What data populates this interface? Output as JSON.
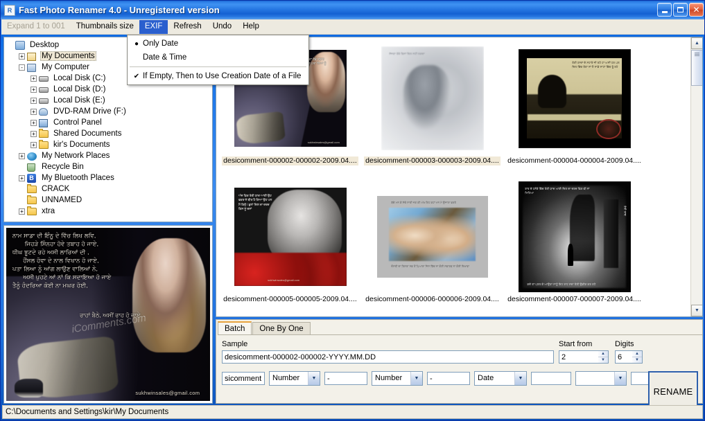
{
  "window": {
    "title": "Fast Photo Renamer 4.0 - Unregistered version",
    "icon": "app-icon",
    "minimize_label": "Minimize",
    "maximize_label": "Maximize",
    "close_label": "Close"
  },
  "menubar": {
    "items": [
      {
        "label": "Expand 1 to 001",
        "state": "disabled"
      },
      {
        "label": "Thumbnails size",
        "state": "normal"
      },
      {
        "label": "EXIF",
        "state": "active"
      },
      {
        "label": "Refresh",
        "state": "normal"
      },
      {
        "label": "Undo",
        "state": "normal"
      },
      {
        "label": "Help",
        "state": "normal"
      }
    ]
  },
  "exif_menu": {
    "items": [
      {
        "label": "Only Date",
        "mark": "●"
      },
      {
        "label": "Date & Time",
        "mark": ""
      },
      {
        "label": "If Empty, Then to Use Creation Date of a File",
        "mark": "✔"
      }
    ]
  },
  "tree": {
    "nodes": [
      {
        "label": "Desktop",
        "indent": 0,
        "expander": "",
        "icon": "desktop-icon",
        "selected": false
      },
      {
        "label": "My Documents",
        "indent": 1,
        "expander": "+",
        "icon": "documents-icon",
        "selected": true
      },
      {
        "label": "My Computer",
        "indent": 1,
        "expander": "-",
        "icon": "computer-icon",
        "selected": false
      },
      {
        "label": "Local Disk (C:)",
        "indent": 2,
        "expander": "+",
        "icon": "disk-icon",
        "selected": false
      },
      {
        "label": "Local Disk (D:)",
        "indent": 2,
        "expander": "+",
        "icon": "disk-icon",
        "selected": false
      },
      {
        "label": "Local Disk (E:)",
        "indent": 2,
        "expander": "+",
        "icon": "disk-icon",
        "selected": false
      },
      {
        "label": "DVD-RAM Drive (F:)",
        "indent": 2,
        "expander": "+",
        "icon": "dvd-drive-icon",
        "selected": false
      },
      {
        "label": "Control Panel",
        "indent": 2,
        "expander": "+",
        "icon": "control-panel-icon",
        "selected": false
      },
      {
        "label": "Shared Documents",
        "indent": 2,
        "expander": "+",
        "icon": "folder-icon",
        "selected": false
      },
      {
        "label": "kir's Documents",
        "indent": 2,
        "expander": "+",
        "icon": "folder-icon",
        "selected": false
      },
      {
        "label": "My Network Places",
        "indent": 1,
        "expander": "+",
        "icon": "network-icon",
        "selected": false
      },
      {
        "label": "Recycle Bin",
        "indent": 1,
        "expander": "",
        "icon": "recycle-bin-icon",
        "selected": false
      },
      {
        "label": "My Bluetooth Places",
        "indent": 1,
        "expander": "+",
        "icon": "bluetooth-icon",
        "selected": false
      },
      {
        "label": "CRACK",
        "indent": 1,
        "expander": "",
        "icon": "folder-icon",
        "selected": false
      },
      {
        "label": "UNNAMED",
        "indent": 1,
        "expander": "",
        "icon": "folder-icon",
        "selected": false
      },
      {
        "label": "xtra",
        "indent": 1,
        "expander": "+",
        "icon": "folder-icon",
        "selected": false
      }
    ]
  },
  "preview": {
    "alt": "Punjabi greeting card photo preview",
    "overlay_text": "ਨਾਮ ਸਾਡਾ ਦੀ ਇੰਨੂ ਦੇ ਵਿੱਚ ਲਿਖ ਲਵਿ,\n       ਜਿਹੜੇ ਸਿੰਨਹਾ ਹੋਵੇ ਤਬਾਹ ਹੋ ਜਾਏ,\nਧੀਘ ਝੂਟਦੇ ਰਹੇ ਅਸੀ ਲਾਰਿਆਂ ਦੀ ,\n      ਹੌਂਸਲ ਹੋਵਾ ਦੇ ਨਾਲ ਵਿਖਾਨ ਹੋ ਜਾਏ,\nਪਤਾ ਲਿਆ ਨੂੰ ਆਂਗ ਲਾਉਣ ਵਾਲਿਆਂ ਨੇ,\n      ਅਸੀ ਪੁਹਟੇ ਆਂ ਨਾਂ ਕਿ ਸਦਾਇਆ ਹੋ ਜਾਏ\nਤੈਨੂੰ ਹੰਦਰਿਆ ਕੋਈ ਨਾ ਮਘਰ ਹੋਈ,",
    "stack_text": "ਰਾਹਾਂ\n\n        ਬੈਠੇ,\n   ਅਸੀਂ\n      ਰਾਹ\n          ਹੋ\n             ਜਾਏ...",
    "watermark": "iComments.com",
    "email": "sukhwinsales@gmail.com"
  },
  "thumbnails": {
    "rows": [
      [
        {
          "caption": "desicomment-000002-000002-2009.04....",
          "selected": true,
          "art": "th1"
        },
        {
          "caption": "desicomment-000003-000003-2009.04....",
          "selected": true,
          "art": "th2"
        },
        {
          "caption": "desicomment-000004-000004-2009.04....",
          "selected": false,
          "art": "th3"
        }
      ],
      [
        {
          "caption": "desicomment-000005-000005-2009.04....",
          "selected": false,
          "art": "th4"
        },
        {
          "caption": "desicomment-000006-000006-2009.04....",
          "selected": false,
          "art": "th5"
        },
        {
          "caption": "desicomment-000007-000007-2009.04....",
          "selected": false,
          "art": "th6"
        }
      ]
    ]
  },
  "thumb_art_text": {
    "th1_lines": "ਨਾਮ ਸਾਡਾ ਦੀ ਇੰਨੂ ਦੇ ਵਿੱਚ\nਜਿਹੜੇ ਸਿੰਨਹਾ ਹੋਵੇ ਤਬਾਹ\nਧੀਘ ਝੂਟਦੇ ਰਹੇ ਅਸੀ\nਹੌਂਸਲ ਹੋਵਾ ਦੇ ਨਾਲ\nਪਤਾ ਲਿਆ ਨੂੰ ਆਂਗ",
    "th1_mail": "sukhwinsales@gmail.com",
    "th2_lines": "ਸੱਜਣਾ ਤੇਰੇ ਬਿਨਾਂ ਦਿਲ ਨਹੀਂ ਲਗਦਾ",
    "th3_wall": "ਤੇਰੀ ਯਾਦਾਂ ਦੇ ਸਹਾਰੇ ਜੀ\nਰਹੇ ਹਾਂ ਅਸੀਂ ਹਰ ਪਲ\nਦਿਲ ਵਿੱਚ ਤੇਰਾ ਨਾਂ ਹੈ\nਸਾਡੇ ਸਾਹਾਂ ਵਿੱਚ ਤੂੰ ਰਹੇ",
    "th4_lines": "ਅੱਜ ਫਿਰ ਤੇਰੀ\nਯਾਦ ਆਈ\nਉਹ ਵਕਤ ਜੋ ਬੀਤ\nਹੈ ਗਿਆ\nਉਹ ਪਲ ਮੈਂ\nਕਿਵੇਂ / ਭੁਲਾਂ\nਦਿਲ ਦਾ ਦਰਦ\nਕਿਸ ਨੂੰ ਦਸਾਂ",
    "th4_mail": "sukhwinsales@gmail.com",
    "th5_top": "ਬੱਚੇ ਮਨ ਕੇ ਸੱਚੇ ਸਾਰੀ ਜਗ ਕੀ ਅੱਖ\nਇਹ ਕਹਾਂ ਮਨ ਮੇ ਉਜਾਲਾ ਭਰਤੇ",
    "th5_bottom": "ਦੋਸਤੀ ਦਾ ਰਿਸ਼ਤਾ ਸਭ ਤੋਂ ਪਿਆਰਾ\nਜਿਸ ਵਿੱਚ ਨਾ ਕੋਈ ਸਵਾਰਥ ਨਾ ਕੋਈ ਦਿਖਾਵਾ",
    "th6_top": "ਰਾਤ ਦੇ ਹਨੇਰੇ ਵਿੱਚ ਤੇਰੀ ਯਾਦ ਆਈ\nਦਿਲ ਦਾ ਦਰਦ ਫਿਰ ਵੀ ਨਾਂ ਮਿਟਿਆ",
    "th6_bottom": "ਕਦੇ ਤਾਂ ਪਰਤ ਕੇ ਆਉਣਾ ਸਾਨੂੰ\nਇਹ ਰਾਹ ਸਦਾ ਤੇਰੀ ਉਡੀਕ ਕਰ ਰਹੇ",
    "th6_right": "ਤੇਰੀ ਯਾਦ"
  },
  "bottom_panel": {
    "tabs": [
      {
        "label": "Batch",
        "active": true
      },
      {
        "label": "One By One",
        "active": false
      }
    ],
    "sample_label": "Sample",
    "sample_value": "desicomment-000002-000002-YYYY.MM.DD",
    "start_from_label": "Start from",
    "start_from_value": "2",
    "digits_label": "Digits",
    "digits_value": "6",
    "rename_label": "RENAME",
    "pattern_fields": [
      {
        "type": "text",
        "value": "sicomment",
        "width": 62
      },
      {
        "type": "combo",
        "value": "Number",
        "width": 74
      },
      {
        "type": "text",
        "value": "-",
        "width": 62
      },
      {
        "type": "combo",
        "value": "Number",
        "width": 74
      },
      {
        "type": "text",
        "value": "-",
        "width": 62
      },
      {
        "type": "combo",
        "value": "Date",
        "width": 76
      },
      {
        "type": "text",
        "value": "",
        "width": 58
      },
      {
        "type": "combo",
        "value": "",
        "width": 74
      },
      {
        "type": "text",
        "value": "",
        "width": 44
      }
    ]
  },
  "statusbar": {
    "path": "C:\\Documents and Settings\\kir\\My Documents"
  },
  "colors": {
    "title_blue": "#1C6FDE",
    "menu_active": "#2A5FCE",
    "menu_bg": "#EDEAE0",
    "selection_bg": "#EFE7D4",
    "panel_bg": "#F3F1E9",
    "tab_accent": "#E8A33D",
    "rename_border": "#2C5EAB"
  },
  "scrollbar": {
    "up_arrow": "▲",
    "down_arrow": "▼"
  }
}
